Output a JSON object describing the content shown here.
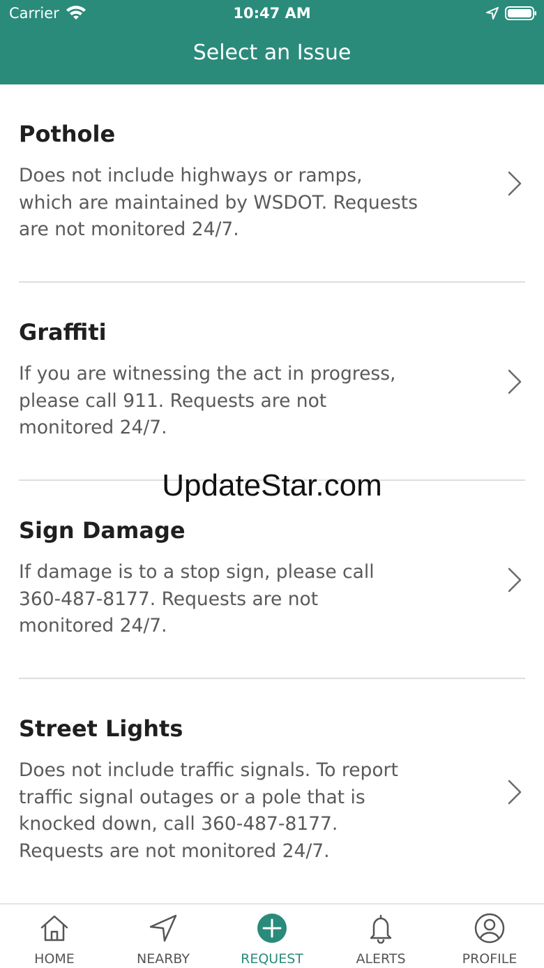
{
  "status_bar": {
    "carrier": "Carrier",
    "time": "10:47 AM"
  },
  "nav": {
    "title": "Select an Issue"
  },
  "issues": [
    {
      "title": "Pothole",
      "lines": [
        "Does not include highways or ramps,",
        "which are maintained by WSDOT. Requests",
        "are not monitored 24/7."
      ]
    },
    {
      "title": "Graffiti",
      "lines": [
        "If you are witnessing the act in progress,",
        "please call 911. Requests are not",
        "monitored 24/7."
      ]
    },
    {
      "title": "Sign Damage",
      "lines": [
        "If damage is to a stop sign, please call",
        "360-487-8177. Requests are not",
        "monitored 24/7."
      ]
    },
    {
      "title": "Street Lights",
      "lines": [
        "Does not include traffic signals. To report",
        "traffic signal outages or a pole that is",
        "knocked down, call 360-487-8177.",
        "Requests are not monitored 24/7."
      ]
    }
  ],
  "watermark": "UpdateStar.com",
  "tabs": [
    {
      "label": "HOME",
      "icon": "home-icon"
    },
    {
      "label": "NEARBY",
      "icon": "navigation-arrow-icon"
    },
    {
      "label": "REQUEST",
      "icon": "plus-circle-icon",
      "active": true
    },
    {
      "label": "ALERTS",
      "icon": "bell-icon"
    },
    {
      "label": "PROFILE",
      "icon": "user-circle-icon"
    }
  ],
  "colors": {
    "accent": "#2a8b7b",
    "title_text": "#1f1f1f",
    "body_text": "#5a5a5a",
    "divider": "#dedede"
  }
}
